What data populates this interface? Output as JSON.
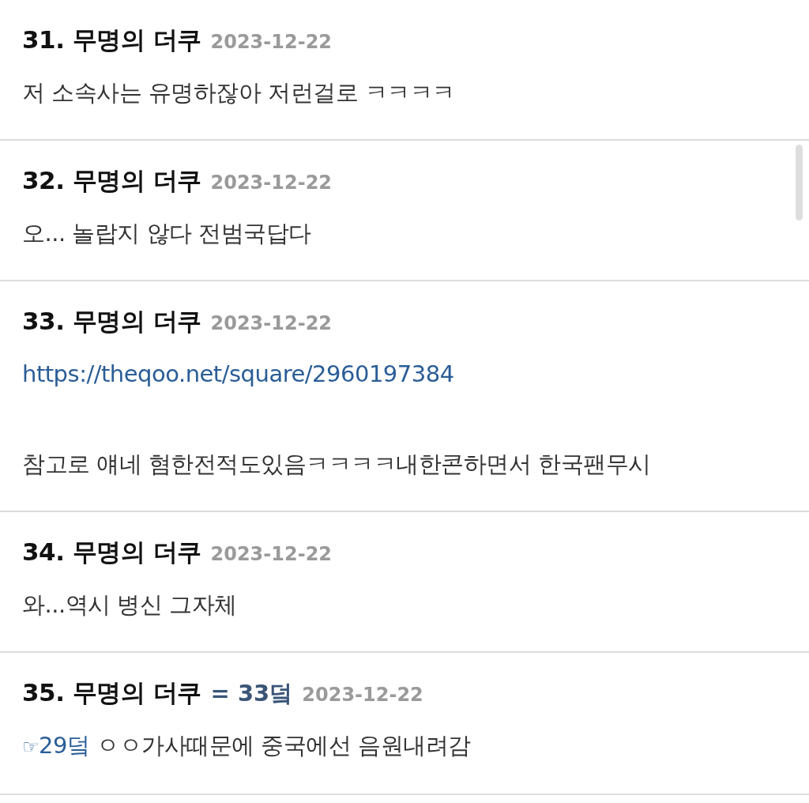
{
  "comments": [
    {
      "number": "31.",
      "author": "무명의 더쿠",
      "date": "2023-12-22",
      "paragraphs": [
        {
          "segments": [
            {
              "kind": "text",
              "text": "저 소속사는 유명하잖아 저런걸로 ㅋㅋㅋㅋ"
            }
          ]
        }
      ]
    },
    {
      "number": "32.",
      "author": "무명의 더쿠",
      "date": "2023-12-22",
      "paragraphs": [
        {
          "segments": [
            {
              "kind": "text",
              "text": "오... 놀랍지 않다 전범국답다"
            }
          ]
        }
      ]
    },
    {
      "number": "33.",
      "author": "무명의 더쿠",
      "date": "2023-12-22",
      "paragraphs": [
        {
          "segments": [
            {
              "kind": "link",
              "text": "https://theqoo.net/square/2960197384"
            }
          ]
        },
        {
          "segments": [
            {
              "kind": "text",
              "text": "참고로 얘네 혐한전적도있음ㅋㅋㅋㅋ내한콘하면서 한국팬무시"
            }
          ]
        }
      ]
    },
    {
      "number": "34.",
      "author": "무명의 더쿠",
      "date": "2023-12-22",
      "paragraphs": [
        {
          "segments": [
            {
              "kind": "text",
              "text": "와...역시 병신 그자체"
            }
          ]
        }
      ]
    },
    {
      "number": "35.",
      "author": "무명의 더쿠",
      "reply_to": "= 33덬",
      "date": "2023-12-22",
      "paragraphs": [
        {
          "segments": [
            {
              "kind": "pointer",
              "text": "☞"
            },
            {
              "kind": "link",
              "text": "29덬"
            },
            {
              "kind": "text",
              "text": " ㅇㅇ가사때문에 중국에선 음원내려감"
            }
          ]
        }
      ]
    }
  ]
}
